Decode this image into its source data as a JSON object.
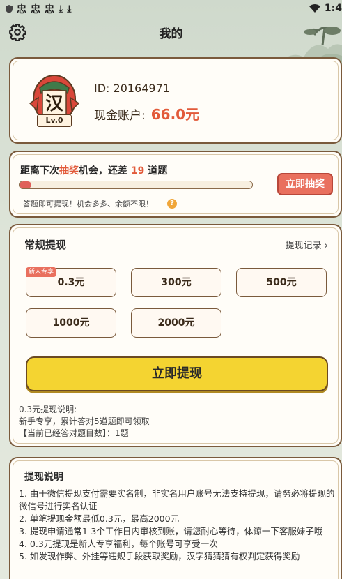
{
  "status_bar": {
    "time": "1:4",
    "left_icons": [
      "shield-icon",
      "bug-icon",
      "bug-icon",
      "bug-icon",
      "download-icon",
      "download-icon"
    ]
  },
  "topbar": {
    "title": "我的",
    "settings_icon": "gear-icon"
  },
  "profile": {
    "avatar_char": "汉",
    "level": "Lv.0",
    "id_line": "ID: 20164971",
    "cash_label": "现金账户:",
    "cash_value": "66.0元"
  },
  "lottery": {
    "msg_prefix": "距离下次",
    "msg_highlight": "抽奖",
    "msg_middle": "机会，还差",
    "msg_count": "19",
    "msg_suffix": "道题",
    "progress": 0.05,
    "hint": "答题即可提现！机会多多、余额不限！",
    "help_icon": "?",
    "draw_button": "立即抽奖"
  },
  "withdraw": {
    "heading": "常规提现",
    "record_link": "提现记录",
    "options": [
      {
        "label": "0.3元",
        "tag": "新人专享"
      },
      {
        "label": "300元"
      },
      {
        "label": "500元"
      },
      {
        "label": "1000元"
      },
      {
        "label": "2000元"
      }
    ],
    "button": "立即提现",
    "note_lines": [
      "0.3元提现说明:",
      "新手专享，累计答对5道题即可领取",
      "【当前已经答对题目数】：1题"
    ]
  },
  "explain": {
    "heading": "提现说明",
    "lines": [
      "1. 由于微信提现支付需要实名制，非实名用户账号无法支持提现，请务必将提现的微信号进行实名认证",
      "2. 单笔提现金额最低0.3元，最高2000元",
      "3. 提现申请通常1-3个工作日内审核到账，请您耐心等待，体谅一下客服妹子哦",
      "4. 0.3元提现是新人专享福利，每个账号可享受一次",
      "5. 如发现作弊、外挂等违规手段获取奖励，汉字猜猜猜有权判定获得奖励"
    ]
  },
  "colors": {
    "accent_red": "#e25a3a",
    "button_yellow": "#f4d431",
    "border_brown": "#7a5a3c"
  }
}
